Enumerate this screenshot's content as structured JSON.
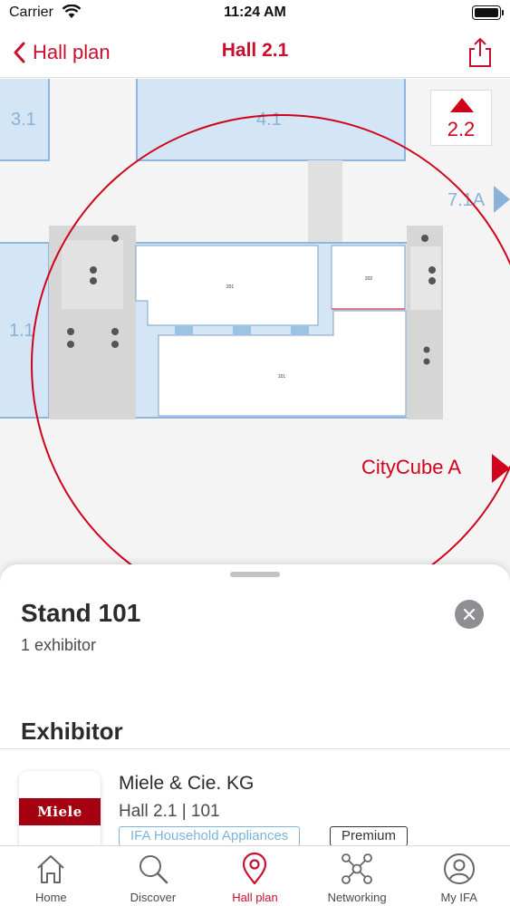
{
  "status_bar": {
    "carrier": "Carrier",
    "time": "11:24 AM",
    "battery_level": 1.0
  },
  "nav": {
    "back_label": "Hall plan",
    "title": "Hall 2.1",
    "share_icon": "share-icon"
  },
  "map": {
    "halls": {
      "h31": "3.1",
      "h41": "4.1",
      "h11": "1.1",
      "h71a": "7.1A",
      "citycube": "CityCube A"
    },
    "other_hall_button": "2.2",
    "stands": {
      "s201": "201",
      "s202": "202",
      "s101": "101"
    },
    "colors": {
      "hall_fill": "#d4e6f6",
      "hall_label": "#8ab2d8",
      "service_area": "#d2d2d2",
      "highlight_circle": "#d0021b"
    }
  },
  "sheet": {
    "stand_title": "Stand 101",
    "exhibitor_count": "1 exhibitor",
    "section_title": "Exhibitor",
    "exhibitors": [
      {
        "name": "Miele & Cie. KG",
        "location": "Hall 2.1 | 101",
        "logo_text": "Miele",
        "category": "IFA Household Appliances",
        "badge": "Premium"
      }
    ]
  },
  "tabs": [
    {
      "label": "Home",
      "icon": "home-icon",
      "active": false
    },
    {
      "label": "Discover",
      "icon": "search-icon",
      "active": false
    },
    {
      "label": "Hall plan",
      "icon": "map-pin-icon",
      "active": true
    },
    {
      "label": "Networking",
      "icon": "network-icon",
      "active": false
    },
    {
      "label": "My IFA",
      "icon": "user-icon",
      "active": false
    }
  ],
  "colors": {
    "accent": "#c8102e",
    "brand_miele": "#a5000f",
    "category_tag": "#7db3df"
  }
}
